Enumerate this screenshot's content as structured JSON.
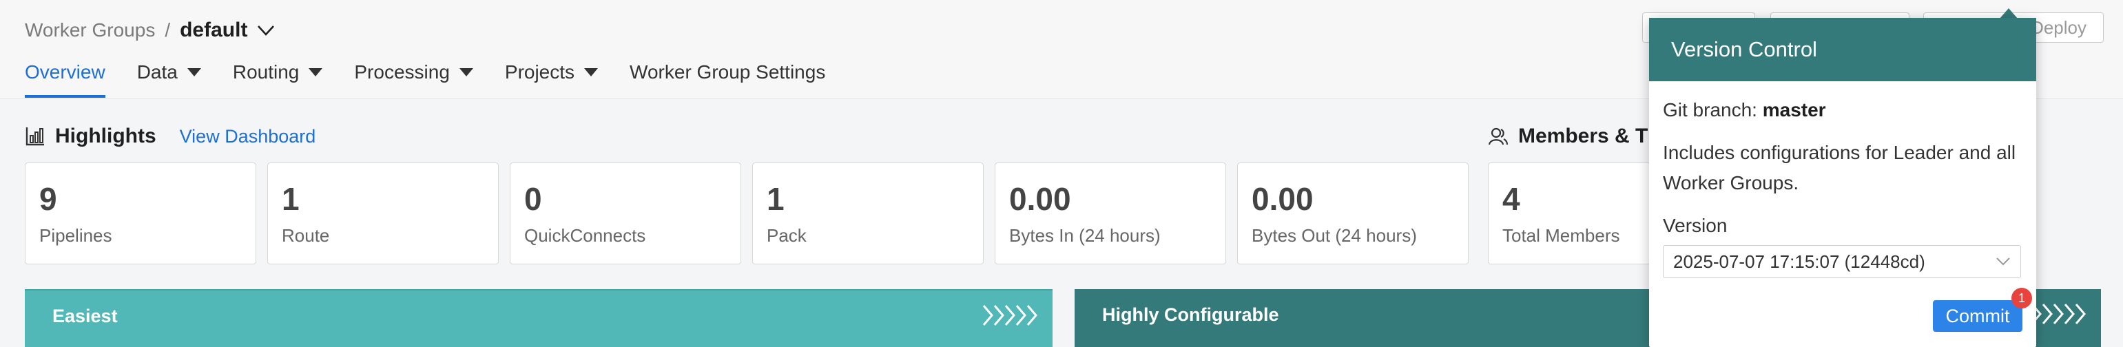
{
  "breadcrumb": {
    "parent": "Worker Groups",
    "separator": "/",
    "current": "default"
  },
  "tabs": [
    {
      "label": "Overview",
      "active": true,
      "has_menu": false
    },
    {
      "label": "Data",
      "has_menu": true
    },
    {
      "label": "Routing",
      "has_menu": true
    },
    {
      "label": "Processing",
      "has_menu": true
    },
    {
      "label": "Projects",
      "has_menu": true
    },
    {
      "label": "Worker Group Settings",
      "has_menu": false
    }
  ],
  "header_actions": {
    "deploy_label": "Deploy"
  },
  "highlights": {
    "title": "Highlights",
    "link": "View Dashboard",
    "icon": "chart-icon",
    "stats": [
      {
        "value": "9",
        "label": "Pipelines"
      },
      {
        "value": "1",
        "label": "Route"
      },
      {
        "value": "0",
        "label": "QuickConnects"
      },
      {
        "value": "1",
        "label": "Pack"
      },
      {
        "value": "0.00",
        "label": "Bytes In (24 hours)"
      },
      {
        "value": "0.00",
        "label": "Bytes Out (24 hours)"
      }
    ]
  },
  "members": {
    "title": "Members & T",
    "icon": "users-icon",
    "stat": {
      "value": "4",
      "label": "Total Members"
    }
  },
  "banners": [
    {
      "label": "Easiest",
      "color": "#52b7b7"
    },
    {
      "label": "Highly Configurable",
      "color": "#357a7a"
    }
  ],
  "version_control": {
    "title": "Version Control",
    "git_branch_label": "Git branch:",
    "git_branch": "master",
    "description": "Includes configurations for Leader and all Worker Groups.",
    "version_label": "Version",
    "version_value": "2025-07-07 17:15:07 (12448cd)",
    "commit_label": "Commit",
    "commit_badge": "1",
    "header_color": "#357a7a"
  },
  "colors": {
    "accent": "#1c6fd9",
    "commit": "#2c83e8",
    "badge": "#e8433c"
  }
}
